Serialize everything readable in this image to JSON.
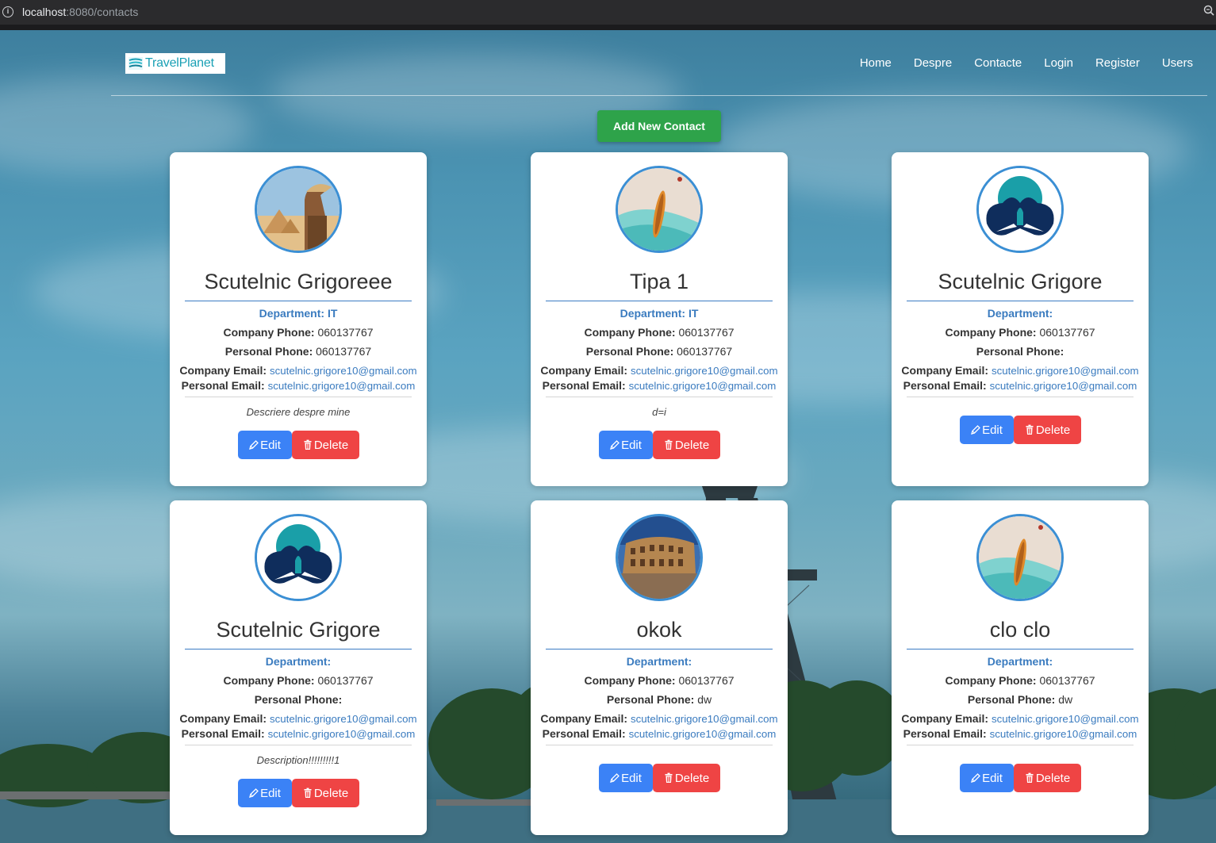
{
  "browser": {
    "url_host": "localhost",
    "url_path": ":8080/contacts"
  },
  "navbar": {
    "brand": "TravelPlanet",
    "links": [
      "Home",
      "Despre",
      "Contacte",
      "Login",
      "Register",
      "Users"
    ]
  },
  "add_button": "Add New Contact",
  "labels": {
    "company_phone": "Company Phone:",
    "personal_phone": "Personal Phone:",
    "company_email": "Company Email:",
    "personal_email": "Personal Email:",
    "edit": "Edit",
    "delete": "Delete"
  },
  "contacts": [
    {
      "name": "Scutelnic Grigoreee",
      "department": "Department: IT",
      "company_phone": "060137767",
      "personal_phone": "060137767",
      "company_email": "scutelnic.grigore10@gmail.com",
      "personal_email": "scutelnic.grigore10@gmail.com",
      "description": "Descriere despre mine",
      "avatar": "pyramids-photo"
    },
    {
      "name": "Tipa 1",
      "department": "Department: IT",
      "company_phone": "060137767",
      "personal_phone": "060137767",
      "company_email": "scutelnic.grigore10@gmail.com",
      "personal_email": "scutelnic.grigore10@gmail.com",
      "description": "d=i",
      "avatar": "beach-boat-photo"
    },
    {
      "name": "Scutelnic Grigore",
      "department": "Department:",
      "company_phone": "060137767",
      "personal_phone": "",
      "company_email": "scutelnic.grigore10@gmail.com",
      "personal_email": "scutelnic.grigore10@gmail.com",
      "description": "",
      "avatar": "default-logo"
    },
    {
      "name": "Scutelnic Grigore",
      "department": "Department:",
      "company_phone": "060137767",
      "personal_phone": "",
      "company_email": "scutelnic.grigore10@gmail.com",
      "personal_email": "scutelnic.grigore10@gmail.com",
      "description": "Description!!!!!!!!!1",
      "avatar": "default-logo"
    },
    {
      "name": "okok",
      "department": "Department:",
      "company_phone": "060137767",
      "personal_phone": "dw",
      "company_email": "scutelnic.grigore10@gmail.com",
      "personal_email": "scutelnic.grigore10@gmail.com",
      "description": "",
      "avatar": "colosseum-photo"
    },
    {
      "name": "clo clo",
      "department": "Department:",
      "company_phone": "060137767",
      "personal_phone": "dw",
      "company_email": "scutelnic.grigore10@gmail.com",
      "personal_email": "scutelnic.grigore10@gmail.com",
      "description": "",
      "avatar": "beach-boat-photo"
    }
  ],
  "colors": {
    "accent_blue": "#3a7bbf",
    "edit_button": "#3b82f6",
    "delete_button": "#ef4444",
    "add_button": "#2ea34a"
  }
}
